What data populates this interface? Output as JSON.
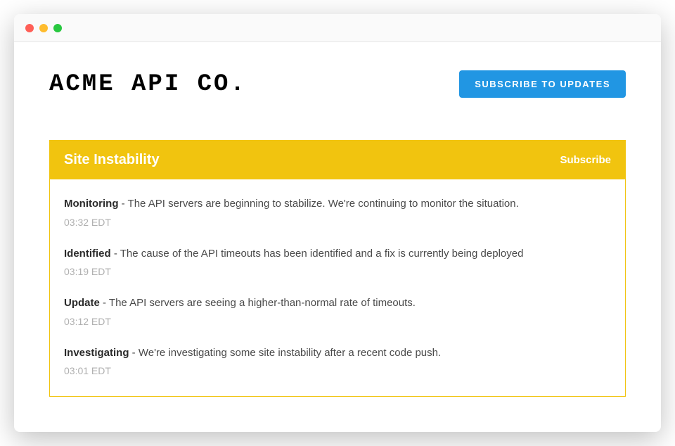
{
  "header": {
    "company_name": "ACME API CO.",
    "subscribe_button": "SUBSCRIBE TO UPDATES"
  },
  "incident": {
    "title": "Site Instability",
    "subscribe_link": "Subscribe",
    "updates": [
      {
        "status": "Monitoring",
        "message": " - The API servers are beginning to stabilize. We're continuing to monitor the situation.",
        "time": "03:32 EDT"
      },
      {
        "status": "Identified",
        "message": " - The cause of the API timeouts has been identified and a fix is currently being deployed",
        "time": "03:19 EDT"
      },
      {
        "status": "Update",
        "message": " - The API servers are seeing a higher-than-normal rate of timeouts.",
        "time": "03:12 EDT"
      },
      {
        "status": "Investigating",
        "message": " - We're investigating some site instability after a recent code push.",
        "time": "03:01 EDT"
      }
    ]
  }
}
